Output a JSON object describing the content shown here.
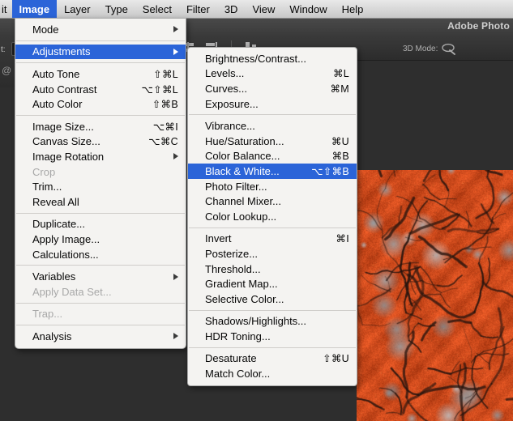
{
  "app": {
    "title": "Adobe Photo",
    "mode3d_label": "3D Mode:",
    "tool_label": "t:",
    "at_icon": "@"
  },
  "menubar": {
    "items": [
      {
        "label": "it",
        "active": false,
        "partial": true
      },
      {
        "label": "Image",
        "active": true,
        "partial": false
      },
      {
        "label": "Layer",
        "active": false,
        "partial": false
      },
      {
        "label": "Type",
        "active": false,
        "partial": false
      },
      {
        "label": "Select",
        "active": false,
        "partial": false
      },
      {
        "label": "Filter",
        "active": false,
        "partial": false
      },
      {
        "label": "3D",
        "active": false,
        "partial": false
      },
      {
        "label": "View",
        "active": false,
        "partial": false
      },
      {
        "label": "Window",
        "active": false,
        "partial": false
      },
      {
        "label": "Help",
        "active": false,
        "partial": false
      }
    ]
  },
  "image_menu": {
    "name": "Image",
    "items": [
      {
        "type": "item",
        "label": "Mode",
        "shortcut": "",
        "submenu": true,
        "disabled": false,
        "selected": false
      },
      {
        "type": "separator"
      },
      {
        "type": "item",
        "label": "Adjustments",
        "shortcut": "",
        "submenu": true,
        "disabled": false,
        "selected": true
      },
      {
        "type": "separator"
      },
      {
        "type": "item",
        "label": "Auto Tone",
        "shortcut": "⇧⌘L",
        "submenu": false,
        "disabled": false,
        "selected": false
      },
      {
        "type": "item",
        "label": "Auto Contrast",
        "shortcut": "⌥⇧⌘L",
        "submenu": false,
        "disabled": false,
        "selected": false
      },
      {
        "type": "item",
        "label": "Auto Color",
        "shortcut": "⇧⌘B",
        "submenu": false,
        "disabled": false,
        "selected": false
      },
      {
        "type": "separator"
      },
      {
        "type": "item",
        "label": "Image Size...",
        "shortcut": "⌥⌘I",
        "submenu": false,
        "disabled": false,
        "selected": false
      },
      {
        "type": "item",
        "label": "Canvas Size...",
        "shortcut": "⌥⌘C",
        "submenu": false,
        "disabled": false,
        "selected": false
      },
      {
        "type": "item",
        "label": "Image Rotation",
        "shortcut": "",
        "submenu": true,
        "disabled": false,
        "selected": false
      },
      {
        "type": "item",
        "label": "Crop",
        "shortcut": "",
        "submenu": false,
        "disabled": true,
        "selected": false
      },
      {
        "type": "item",
        "label": "Trim...",
        "shortcut": "",
        "submenu": false,
        "disabled": false,
        "selected": false
      },
      {
        "type": "item",
        "label": "Reveal All",
        "shortcut": "",
        "submenu": false,
        "disabled": false,
        "selected": false
      },
      {
        "type": "separator"
      },
      {
        "type": "item",
        "label": "Duplicate...",
        "shortcut": "",
        "submenu": false,
        "disabled": false,
        "selected": false
      },
      {
        "type": "item",
        "label": "Apply Image...",
        "shortcut": "",
        "submenu": false,
        "disabled": false,
        "selected": false
      },
      {
        "type": "item",
        "label": "Calculations...",
        "shortcut": "",
        "submenu": false,
        "disabled": false,
        "selected": false
      },
      {
        "type": "separator"
      },
      {
        "type": "item",
        "label": "Variables",
        "shortcut": "",
        "submenu": true,
        "disabled": false,
        "selected": false
      },
      {
        "type": "item",
        "label": "Apply Data Set...",
        "shortcut": "",
        "submenu": false,
        "disabled": true,
        "selected": false
      },
      {
        "type": "separator"
      },
      {
        "type": "item",
        "label": "Trap...",
        "shortcut": "",
        "submenu": false,
        "disabled": true,
        "selected": false
      },
      {
        "type": "separator"
      },
      {
        "type": "item",
        "label": "Analysis",
        "shortcut": "",
        "submenu": true,
        "disabled": false,
        "selected": false
      }
    ]
  },
  "adjustments_menu": {
    "name": "Adjustments",
    "items": [
      {
        "type": "item",
        "label": "Brightness/Contrast...",
        "shortcut": "",
        "submenu": false,
        "disabled": false,
        "selected": false
      },
      {
        "type": "item",
        "label": "Levels...",
        "shortcut": "⌘L",
        "submenu": false,
        "disabled": false,
        "selected": false
      },
      {
        "type": "item",
        "label": "Curves...",
        "shortcut": "⌘M",
        "submenu": false,
        "disabled": false,
        "selected": false
      },
      {
        "type": "item",
        "label": "Exposure...",
        "shortcut": "",
        "submenu": false,
        "disabled": false,
        "selected": false
      },
      {
        "type": "separator"
      },
      {
        "type": "item",
        "label": "Vibrance...",
        "shortcut": "",
        "submenu": false,
        "disabled": false,
        "selected": false
      },
      {
        "type": "item",
        "label": "Hue/Saturation...",
        "shortcut": "⌘U",
        "submenu": false,
        "disabled": false,
        "selected": false
      },
      {
        "type": "item",
        "label": "Color Balance...",
        "shortcut": "⌘B",
        "submenu": false,
        "disabled": false,
        "selected": false
      },
      {
        "type": "item",
        "label": "Black & White...",
        "shortcut": "⌥⇧⌘B",
        "submenu": false,
        "disabled": false,
        "selected": true
      },
      {
        "type": "item",
        "label": "Photo Filter...",
        "shortcut": "",
        "submenu": false,
        "disabled": false,
        "selected": false
      },
      {
        "type": "item",
        "label": "Channel Mixer...",
        "shortcut": "",
        "submenu": false,
        "disabled": false,
        "selected": false
      },
      {
        "type": "item",
        "label": "Color Lookup...",
        "shortcut": "",
        "submenu": false,
        "disabled": false,
        "selected": false
      },
      {
        "type": "separator"
      },
      {
        "type": "item",
        "label": "Invert",
        "shortcut": "⌘I",
        "submenu": false,
        "disabled": false,
        "selected": false
      },
      {
        "type": "item",
        "label": "Posterize...",
        "shortcut": "",
        "submenu": false,
        "disabled": false,
        "selected": false
      },
      {
        "type": "item",
        "label": "Threshold...",
        "shortcut": "",
        "submenu": false,
        "disabled": false,
        "selected": false
      },
      {
        "type": "item",
        "label": "Gradient Map...",
        "shortcut": "",
        "submenu": false,
        "disabled": false,
        "selected": false
      },
      {
        "type": "item",
        "label": "Selective Color...",
        "shortcut": "",
        "submenu": false,
        "disabled": false,
        "selected": false
      },
      {
        "type": "separator"
      },
      {
        "type": "item",
        "label": "Shadows/Highlights...",
        "shortcut": "",
        "submenu": false,
        "disabled": false,
        "selected": false
      },
      {
        "type": "item",
        "label": "HDR Toning...",
        "shortcut": "",
        "submenu": false,
        "disabled": false,
        "selected": false
      },
      {
        "type": "separator"
      },
      {
        "type": "item",
        "label": "Desaturate",
        "shortcut": "⇧⌘U",
        "submenu": false,
        "disabled": false,
        "selected": false
      },
      {
        "type": "item",
        "label": "Match Color...",
        "shortcut": "",
        "submenu": false,
        "disabled": false,
        "selected": false
      }
    ]
  },
  "colors": {
    "highlight": "#2b64d8",
    "menu_bg": "#f4f3f1",
    "app_bg": "#2e2e2e",
    "photo_dominant": "#d8441a"
  },
  "photo": {
    "description": "cracked red-orange rock texture"
  }
}
